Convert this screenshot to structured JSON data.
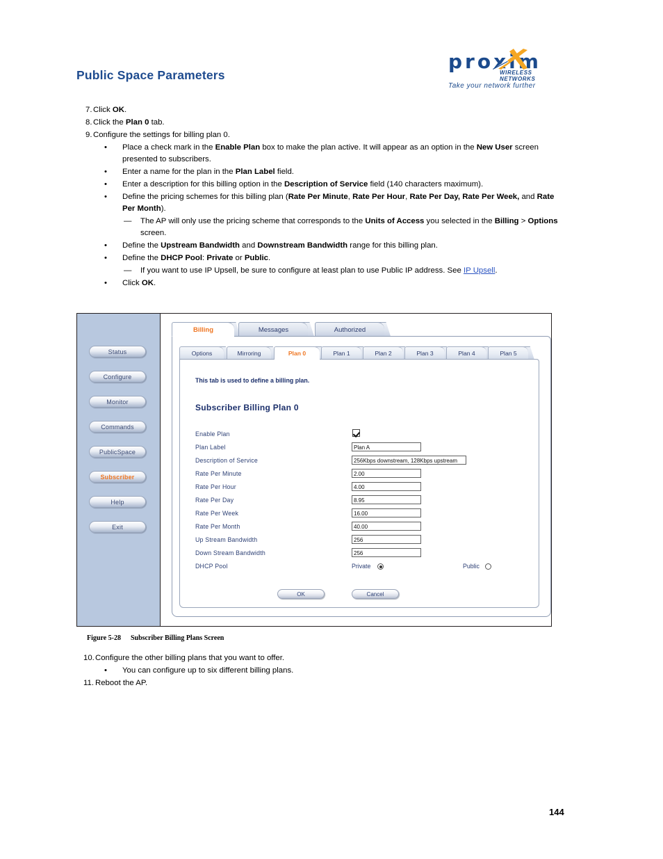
{
  "header": {
    "doc_title": "Public Space Parameters",
    "logo": {
      "wordmark": "proxim",
      "tagline_small": "WIRELESS NETWORKS",
      "tagline": "Take your network further",
      "brand_blue": "#1b4a8c",
      "brand_orange": "#f5a623"
    }
  },
  "steps": {
    "s7": {
      "num": "7.",
      "t1": "Click ",
      "b1": "OK",
      "t2": "."
    },
    "s8": {
      "num": "8.",
      "t1": "Click the ",
      "b1": "Plan 0",
      "t2": " tab."
    },
    "s9": {
      "num": "9.",
      "t1": "Configure the settings for billing plan 0."
    },
    "b1": {
      "bullet": "•",
      "t1": "Place a check mark in the ",
      "b1": "Enable Plan",
      "t2": " box to make the plan active. It will appear as an option in the ",
      "b2": "New User",
      "t3": " screen presented to subscribers."
    },
    "b2": {
      "bullet": "•",
      "t1": "Enter a name for the plan in the ",
      "b1": "Plan Label",
      "t2": " field."
    },
    "b3": {
      "bullet": "•",
      "t1": "Enter a description for this billing option in the ",
      "b1": "Description of Service",
      "t2": " field (140 characters maximum)."
    },
    "b4": {
      "bullet": "•",
      "t1": "Define the pricing schemes for this billing plan (",
      "b1": "Rate Per Minute",
      "t2": ", ",
      "b2": "Rate Per Hour",
      "t3": ", ",
      "b3": "Rate Per Day, Rate Per Week,",
      "t4": " and ",
      "b4": "Rate Per Month",
      "t5": ")."
    },
    "d1": {
      "dash": "—",
      "t1": "The AP will only use the pricing scheme that corresponds to the ",
      "b1": "Units of Access",
      "t2": " you selected in the ",
      "b2": "Billing",
      "t3": " > ",
      "b3": "Options",
      "t4": " screen."
    },
    "b5": {
      "bullet": "•",
      "t1": "Define the ",
      "b1": "Upstream Bandwidth",
      "t2": " and ",
      "b2": "Downstream Bandwidth",
      "t3": " range for this billing plan."
    },
    "b6": {
      "bullet": "•",
      "t1": "Define the ",
      "b1": "DHCP Pool",
      "t2": ": ",
      "b2": "Private",
      "t3": " or ",
      "b3": "Public",
      "t4": "."
    },
    "d2": {
      "dash": "—",
      "t1": "If you want to use IP Upsell, be sure to configure at least plan to use Public IP address. See ",
      "link": "IP Upsell",
      "t2": "."
    },
    "b7": {
      "bullet": "•",
      "t1": "Click ",
      "b1": "OK",
      "t2": "."
    }
  },
  "figure": {
    "sidebar": [
      {
        "label": "Status",
        "active": false
      },
      {
        "label": "Configure",
        "active": false
      },
      {
        "label": "Monitor",
        "active": false
      },
      {
        "label": "Commands",
        "active": false
      },
      {
        "label": "PublicSpace",
        "active": false
      },
      {
        "label": "Subscriber",
        "active": true
      },
      {
        "label": "Help",
        "active": false
      },
      {
        "label": "Exit",
        "active": false
      }
    ],
    "primary_tabs": [
      {
        "label": "Billing",
        "selected": true
      },
      {
        "label": "Messages",
        "selected": false
      },
      {
        "label": "Authorized",
        "selected": false
      }
    ],
    "secondary_tabs": [
      {
        "label": "Options",
        "selected": false
      },
      {
        "label": "Mirroring",
        "selected": false
      },
      {
        "label": "Plan 0",
        "selected": true
      },
      {
        "label": "Plan 1",
        "selected": false
      },
      {
        "label": "Plan 2",
        "selected": false
      },
      {
        "label": "Plan 3",
        "selected": false
      },
      {
        "label": "Plan 4",
        "selected": false
      },
      {
        "label": "Plan 5",
        "selected": false
      }
    ],
    "intro_text": "This tab is used to define a billing plan.",
    "section_title": "Subscriber Billing Plan 0",
    "fields": [
      {
        "label": "Enable Plan",
        "type": "checkbox",
        "checked": true
      },
      {
        "label": "Plan Label",
        "type": "text",
        "value": "Plan A"
      },
      {
        "label": "Description of Service",
        "type": "text",
        "value": "256Kbps downstream, 128Kbps upstream"
      },
      {
        "label": "Rate Per Minute",
        "type": "text",
        "value": "2.00"
      },
      {
        "label": "Rate Per Hour",
        "type": "text",
        "value": "4.00"
      },
      {
        "label": "Rate Per Day",
        "type": "text",
        "value": "8.95"
      },
      {
        "label": "Rate Per Week",
        "type": "text",
        "value": "16.00"
      },
      {
        "label": "Rate Per Month",
        "type": "text",
        "value": "40.00"
      },
      {
        "label": "Up Stream Bandwidth",
        "type": "text",
        "value": "256"
      },
      {
        "label": "Down Stream Bandwidth",
        "type": "text",
        "value": "256"
      }
    ],
    "dhcp": {
      "label": "DHCP Pool",
      "option_private": "Private",
      "option_public": "Public",
      "selected": "Private"
    },
    "buttons": {
      "ok": "OK",
      "cancel": "Cancel"
    }
  },
  "caption": {
    "number": "Figure 5-28",
    "title": "Subscriber Billing Plans Screen"
  },
  "steps2": {
    "s10": {
      "num": "10.",
      "t1": "Configure the other billing plans that you want to offer."
    },
    "b8": {
      "bullet": "•",
      "t1": "You can configure up to six different billing plans."
    },
    "s11": {
      "num": "11.",
      "t1": "Reboot the AP."
    }
  },
  "footer": {
    "page_number": "144"
  }
}
